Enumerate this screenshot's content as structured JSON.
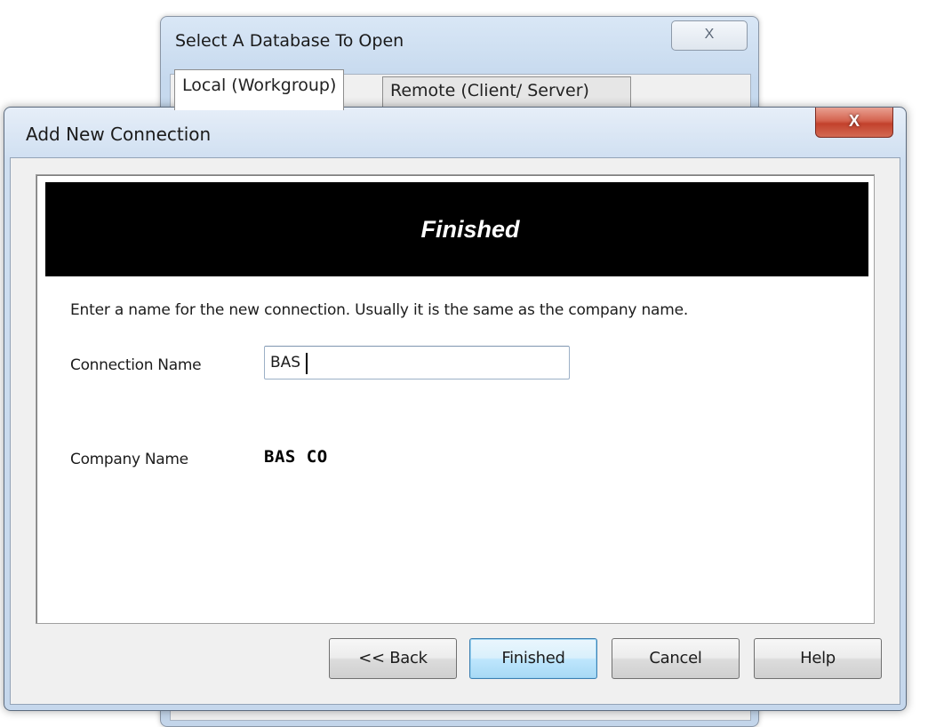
{
  "background_window": {
    "title": "Select A  Database To Open",
    "close_glyph": "X",
    "tabs": [
      {
        "label": "Local (Workgroup)",
        "active": true
      },
      {
        "label": "Remote (Client/ Server)",
        "active": false
      }
    ]
  },
  "dialog": {
    "title": "Add New Connection",
    "close_glyph": "X",
    "banner": "Finished",
    "instruction": "Enter a name for the new connection. Usually it is the same as the company name.",
    "connection_name": {
      "label": "Connection Name",
      "value": "BAS "
    },
    "company_name": {
      "label": "Company Name",
      "value": "BAS CO"
    },
    "buttons": {
      "back": "<< Back",
      "finished": "Finished",
      "cancel": "Cancel",
      "help": "Help"
    }
  },
  "colors": {
    "banner_bg": "#000000",
    "banner_text": "#ffffff",
    "close_button": "#c2412c",
    "default_button_border": "#3c7fb1"
  }
}
